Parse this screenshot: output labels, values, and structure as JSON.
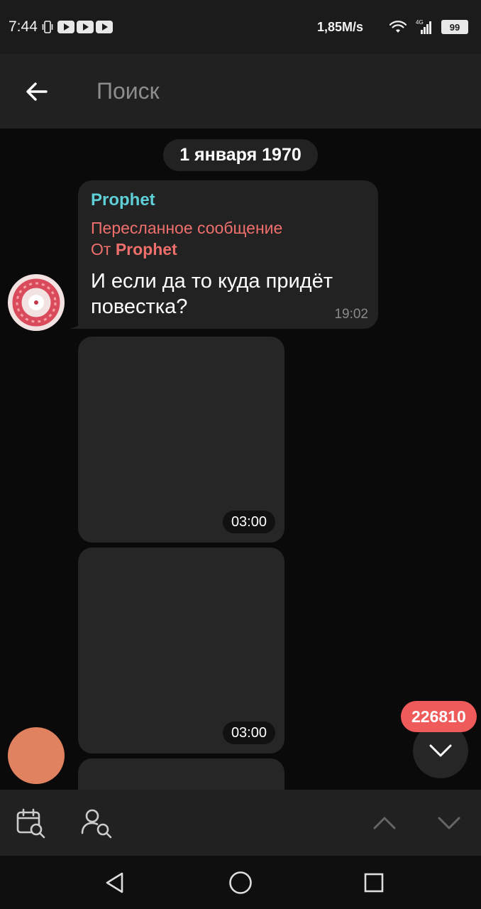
{
  "status_bar": {
    "time": "7:44",
    "speed": "1,85M/s",
    "network": "4G",
    "battery": "99"
  },
  "header": {
    "search_placeholder": "Поиск"
  },
  "chat": {
    "date": "1 января 1970",
    "message": {
      "sender": "Prophet",
      "forwarded_label": "Пересланное сообщение",
      "from_prefix": "От",
      "from_name": "Prophet",
      "text": "И если да то куда придёт повестка?",
      "time": "19:02"
    },
    "videos": [
      {
        "duration": "03:00"
      },
      {
        "duration": "03:00"
      }
    ],
    "unread_count": "226810"
  },
  "colors": {
    "sender": "#5ecfd6",
    "forwarded": "#ef6f6c",
    "badge": "#ef5a5a",
    "avatar_2": "#e0815f"
  },
  "toolbar": {
    "icons": [
      "calendar-search-icon",
      "user-search-icon",
      "chevron-up-icon",
      "chevron-down-icon"
    ]
  }
}
